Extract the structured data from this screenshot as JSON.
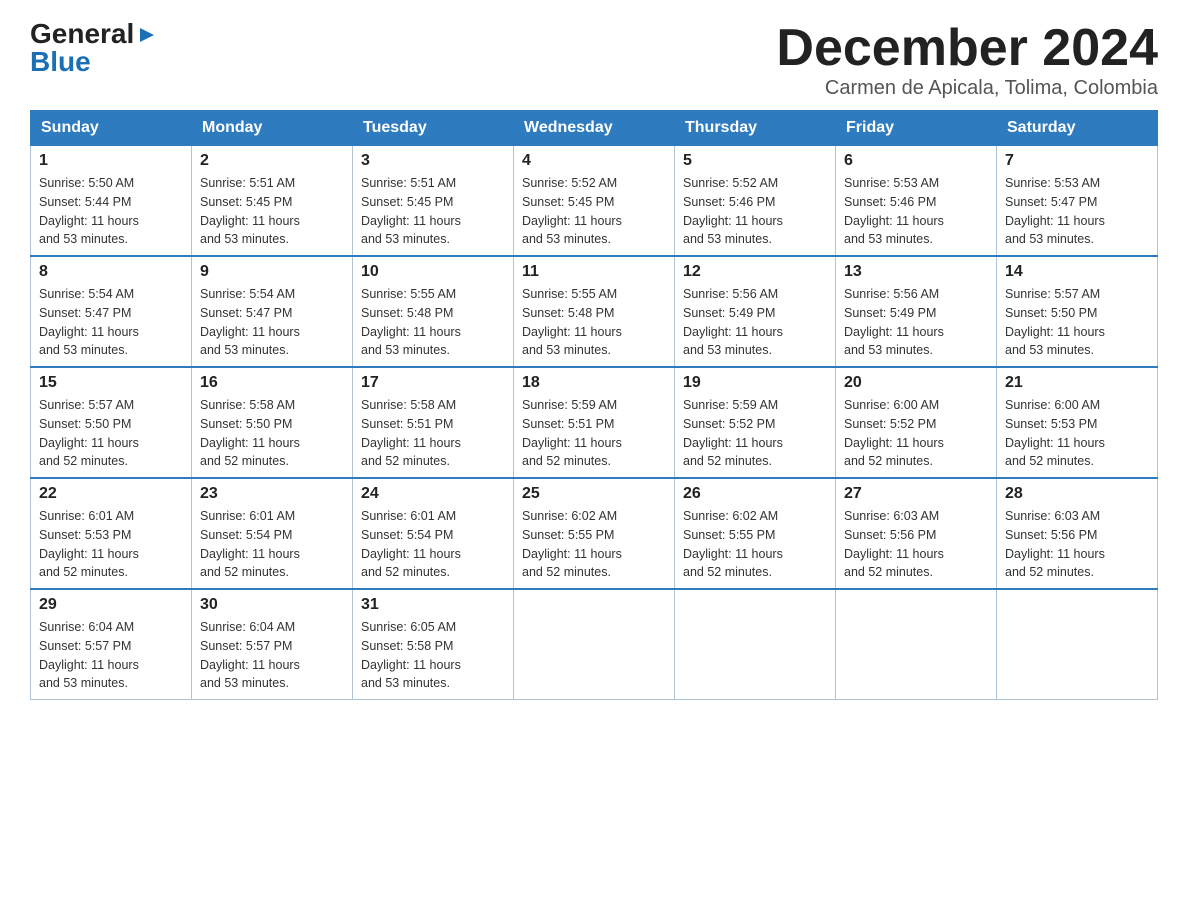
{
  "logo": {
    "general": "General",
    "blue": "Blue"
  },
  "title": "December 2024",
  "location": "Carmen de Apicala, Tolima, Colombia",
  "days_of_week": [
    "Sunday",
    "Monday",
    "Tuesday",
    "Wednesday",
    "Thursday",
    "Friday",
    "Saturday"
  ],
  "weeks": [
    [
      {
        "day": "1",
        "sunrise": "5:50 AM",
        "sunset": "5:44 PM",
        "daylight": "11 hours and 53 minutes."
      },
      {
        "day": "2",
        "sunrise": "5:51 AM",
        "sunset": "5:45 PM",
        "daylight": "11 hours and 53 minutes."
      },
      {
        "day": "3",
        "sunrise": "5:51 AM",
        "sunset": "5:45 PM",
        "daylight": "11 hours and 53 minutes."
      },
      {
        "day": "4",
        "sunrise": "5:52 AM",
        "sunset": "5:45 PM",
        "daylight": "11 hours and 53 minutes."
      },
      {
        "day": "5",
        "sunrise": "5:52 AM",
        "sunset": "5:46 PM",
        "daylight": "11 hours and 53 minutes."
      },
      {
        "day": "6",
        "sunrise": "5:53 AM",
        "sunset": "5:46 PM",
        "daylight": "11 hours and 53 minutes."
      },
      {
        "day": "7",
        "sunrise": "5:53 AM",
        "sunset": "5:47 PM",
        "daylight": "11 hours and 53 minutes."
      }
    ],
    [
      {
        "day": "8",
        "sunrise": "5:54 AM",
        "sunset": "5:47 PM",
        "daylight": "11 hours and 53 minutes."
      },
      {
        "day": "9",
        "sunrise": "5:54 AM",
        "sunset": "5:47 PM",
        "daylight": "11 hours and 53 minutes."
      },
      {
        "day": "10",
        "sunrise": "5:55 AM",
        "sunset": "5:48 PM",
        "daylight": "11 hours and 53 minutes."
      },
      {
        "day": "11",
        "sunrise": "5:55 AM",
        "sunset": "5:48 PM",
        "daylight": "11 hours and 53 minutes."
      },
      {
        "day": "12",
        "sunrise": "5:56 AM",
        "sunset": "5:49 PM",
        "daylight": "11 hours and 53 minutes."
      },
      {
        "day": "13",
        "sunrise": "5:56 AM",
        "sunset": "5:49 PM",
        "daylight": "11 hours and 53 minutes."
      },
      {
        "day": "14",
        "sunrise": "5:57 AM",
        "sunset": "5:50 PM",
        "daylight": "11 hours and 53 minutes."
      }
    ],
    [
      {
        "day": "15",
        "sunrise": "5:57 AM",
        "sunset": "5:50 PM",
        "daylight": "11 hours and 52 minutes."
      },
      {
        "day": "16",
        "sunrise": "5:58 AM",
        "sunset": "5:50 PM",
        "daylight": "11 hours and 52 minutes."
      },
      {
        "day": "17",
        "sunrise": "5:58 AM",
        "sunset": "5:51 PM",
        "daylight": "11 hours and 52 minutes."
      },
      {
        "day": "18",
        "sunrise": "5:59 AM",
        "sunset": "5:51 PM",
        "daylight": "11 hours and 52 minutes."
      },
      {
        "day": "19",
        "sunrise": "5:59 AM",
        "sunset": "5:52 PM",
        "daylight": "11 hours and 52 minutes."
      },
      {
        "day": "20",
        "sunrise": "6:00 AM",
        "sunset": "5:52 PM",
        "daylight": "11 hours and 52 minutes."
      },
      {
        "day": "21",
        "sunrise": "6:00 AM",
        "sunset": "5:53 PM",
        "daylight": "11 hours and 52 minutes."
      }
    ],
    [
      {
        "day": "22",
        "sunrise": "6:01 AM",
        "sunset": "5:53 PM",
        "daylight": "11 hours and 52 minutes."
      },
      {
        "day": "23",
        "sunrise": "6:01 AM",
        "sunset": "5:54 PM",
        "daylight": "11 hours and 52 minutes."
      },
      {
        "day": "24",
        "sunrise": "6:01 AM",
        "sunset": "5:54 PM",
        "daylight": "11 hours and 52 minutes."
      },
      {
        "day": "25",
        "sunrise": "6:02 AM",
        "sunset": "5:55 PM",
        "daylight": "11 hours and 52 minutes."
      },
      {
        "day": "26",
        "sunrise": "6:02 AM",
        "sunset": "5:55 PM",
        "daylight": "11 hours and 52 minutes."
      },
      {
        "day": "27",
        "sunrise": "6:03 AM",
        "sunset": "5:56 PM",
        "daylight": "11 hours and 52 minutes."
      },
      {
        "day": "28",
        "sunrise": "6:03 AM",
        "sunset": "5:56 PM",
        "daylight": "11 hours and 52 minutes."
      }
    ],
    [
      {
        "day": "29",
        "sunrise": "6:04 AM",
        "sunset": "5:57 PM",
        "daylight": "11 hours and 53 minutes."
      },
      {
        "day": "30",
        "sunrise": "6:04 AM",
        "sunset": "5:57 PM",
        "daylight": "11 hours and 53 minutes."
      },
      {
        "day": "31",
        "sunrise": "6:05 AM",
        "sunset": "5:58 PM",
        "daylight": "11 hours and 53 minutes."
      },
      null,
      null,
      null,
      null
    ]
  ],
  "labels": {
    "sunrise": "Sunrise:",
    "sunset": "Sunset:",
    "daylight": "Daylight:"
  }
}
